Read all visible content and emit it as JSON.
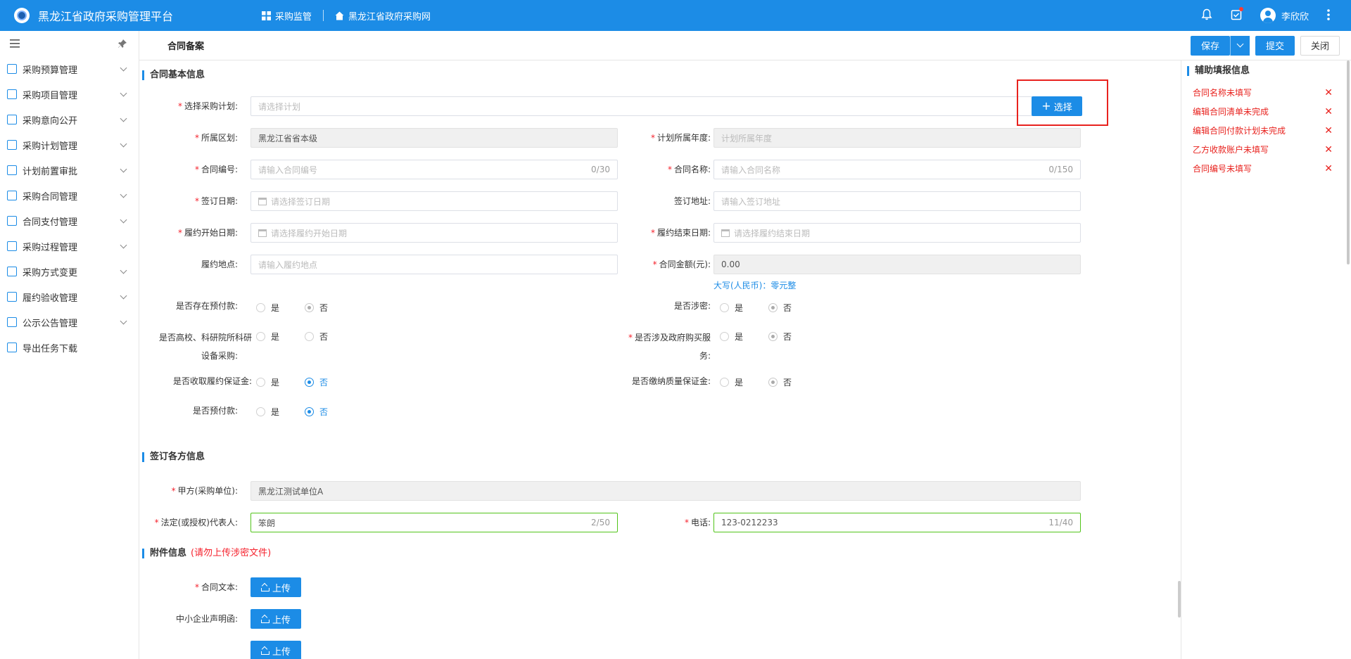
{
  "app": {
    "title": "黑龙江省政府采购管理平台"
  },
  "topnav": [
    {
      "label": "采购监管",
      "icon": "grid-icon"
    },
    {
      "label": "黑龙江省政府采购网",
      "icon": "home-icon"
    }
  ],
  "user": {
    "name": "李欣欣"
  },
  "sidebar": {
    "items": [
      {
        "label": "采购预算管理"
      },
      {
        "label": "采购项目管理"
      },
      {
        "label": "采购意向公开"
      },
      {
        "label": "采购计划管理"
      },
      {
        "label": "计划前置审批"
      },
      {
        "label": "采购合同管理"
      },
      {
        "label": "合同支付管理"
      },
      {
        "label": "采购过程管理"
      },
      {
        "label": "采购方式变更"
      },
      {
        "label": "履约验收管理"
      },
      {
        "label": "公示公告管理"
      },
      {
        "label": "导出任务下载"
      }
    ]
  },
  "header": {
    "title": "合同备案",
    "save_label": "保存",
    "submit_label": "提交",
    "close_label": "关闭"
  },
  "basic": {
    "section_title": "合同基本信息",
    "plan": {
      "label": "选择采购计划:",
      "placeholder": "请选择计划",
      "button": "选择"
    },
    "region": {
      "label": "所属区划:",
      "value": "黑龙江省省本级"
    },
    "plan_year": {
      "label": "计划所属年度:",
      "placeholder": "计划所属年度"
    },
    "contract_no": {
      "label": "合同编号:",
      "placeholder": "请输入合同编号",
      "count": "0/30"
    },
    "contract_name": {
      "label": "合同名称:",
      "placeholder": "请输入合同名称",
      "count": "0/150"
    },
    "sign_date": {
      "label": "签订日期:",
      "placeholder": "请选择签订日期"
    },
    "sign_place": {
      "label": "签订地址:",
      "placeholder": "请输入签订地址"
    },
    "start_date": {
      "label": "履约开始日期:",
      "placeholder": "请选择履约开始日期"
    },
    "end_date": {
      "label": "履约结束日期:",
      "placeholder": "请选择履约结束日期"
    },
    "perform_place": {
      "label": "履约地点:",
      "placeholder": "请输入履约地点"
    },
    "amount": {
      "label": "合同金额(元):",
      "value": "0.00",
      "capital": "大写(人民币)：零元整"
    },
    "yes": "是",
    "no": "否",
    "prepay_exists": {
      "label": "是否存在预付款:"
    },
    "secret": {
      "label": "是否涉密:"
    },
    "university_1": "是否高校、科研院所科研",
    "university_2": "设备采购:",
    "gov_service_1": "是否涉及政府购买服",
    "gov_service_2": "务:",
    "perf_bond": {
      "label": "是否收取履约保证金:"
    },
    "quality_bond": {
      "label": "是否缴纳质量保证金:"
    },
    "prepay": {
      "label": "是否预付款:"
    }
  },
  "parties": {
    "section_title": "签订各方信息",
    "party_a": {
      "label": "甲方(采购单位):",
      "value": "黑龙江测试单位A"
    },
    "legal_rep": {
      "label": "法定(或授权)代表人:",
      "value": "笨朗",
      "count": "2/50"
    },
    "phone": {
      "label": "电话:",
      "value": "123-0212233",
      "count": "11/40"
    }
  },
  "attachments": {
    "section_title": "附件信息",
    "warning": "(请勿上传涉密文件)",
    "contract_text": {
      "label": "合同文本:"
    },
    "sme": {
      "label": "中小企业声明函:"
    },
    "upload_label": "上传"
  },
  "right_panel": {
    "title": "辅助填报信息",
    "items": [
      "合同名称未填写",
      "编辑合同清单未完成",
      "编辑合同付款计划未完成",
      "乙方收款账户未填写",
      "合同编号未填写"
    ],
    "close_glyph": "✕"
  },
  "colors": {
    "brand": "#1c8ce6",
    "error": "#e8221e",
    "success": "#52c41a"
  }
}
